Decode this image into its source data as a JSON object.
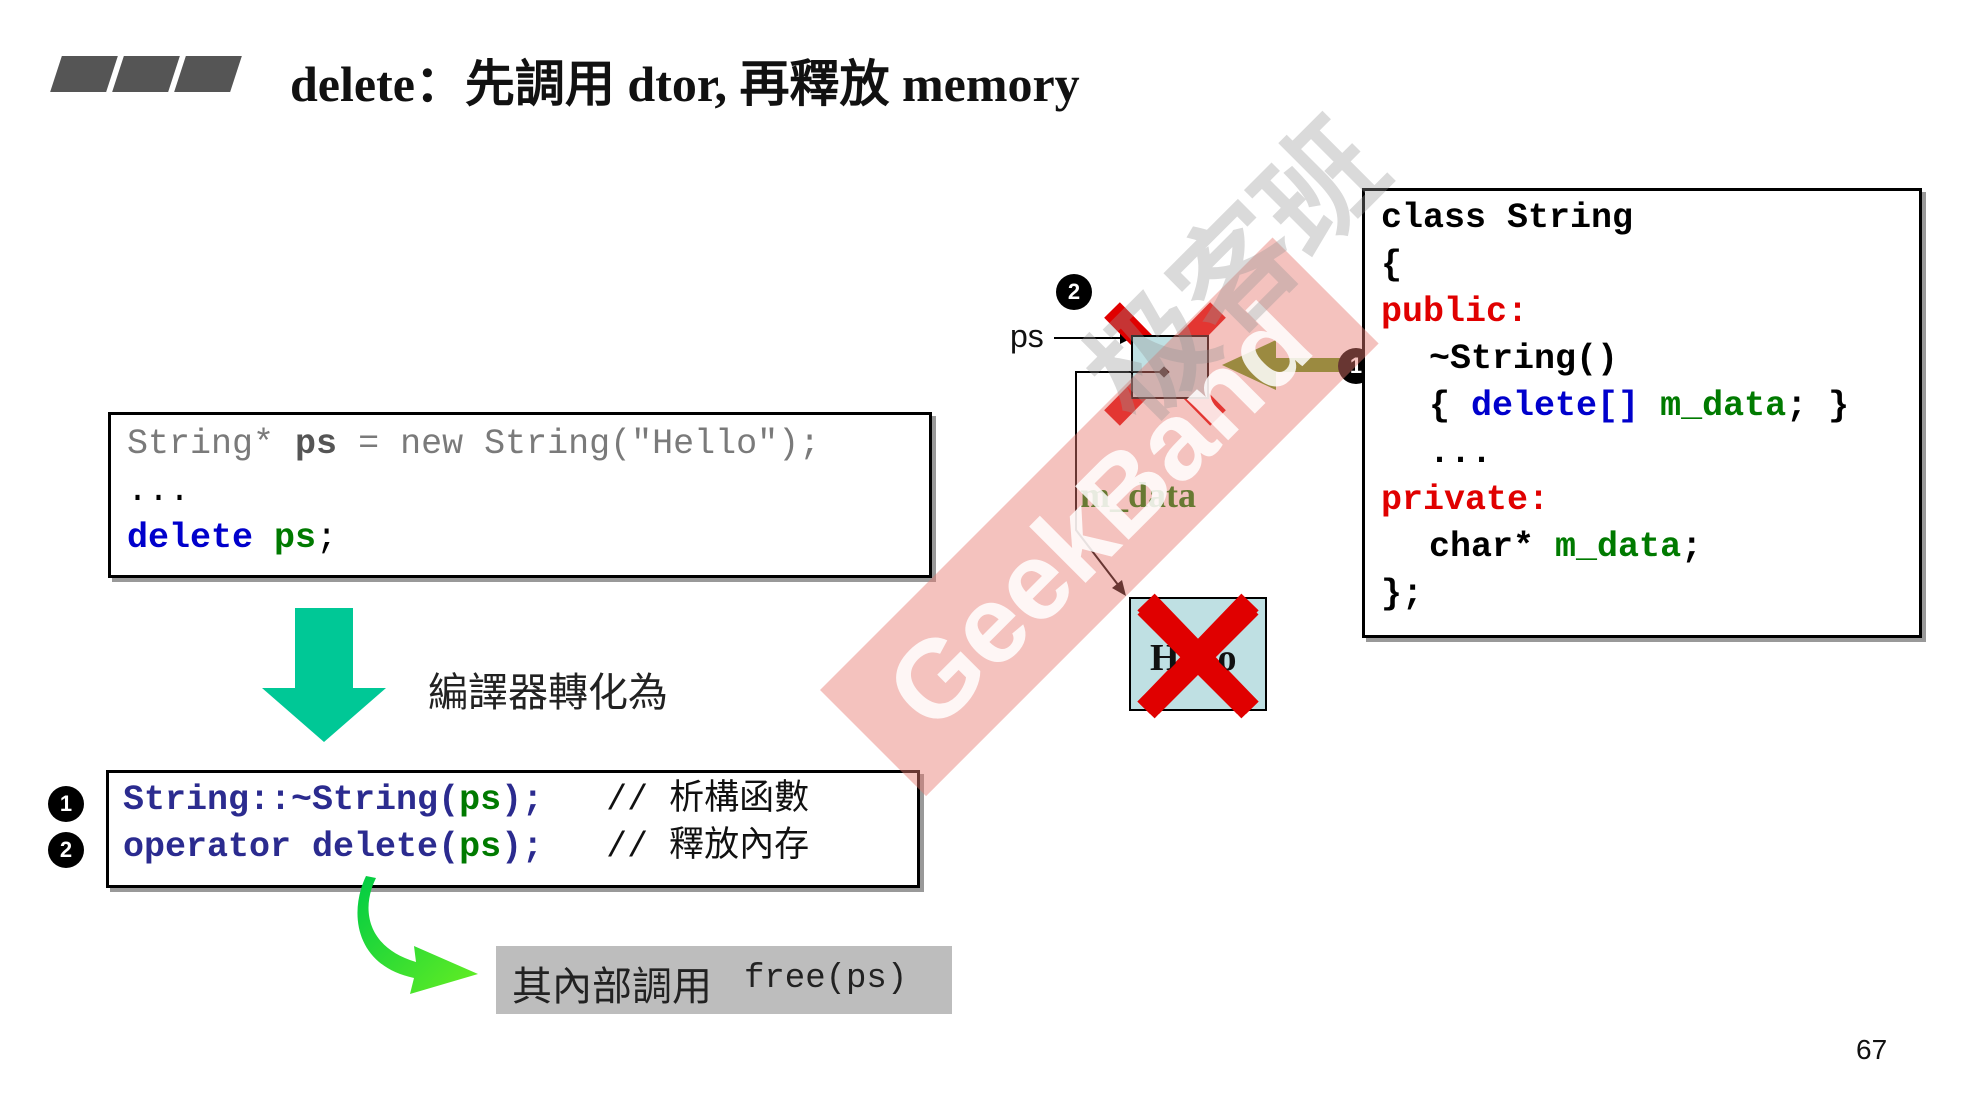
{
  "header": {
    "title": "delete：先調用 dtor, 再釋放 memory"
  },
  "source_code": {
    "line1": "String* ps = new String(\"Hello\");",
    "line1_parts": {
      "type": "String*",
      "var": "ps",
      "rest": " = new String(\"Hello\");"
    },
    "line2": "...",
    "line3_kw": "delete",
    "line3_var": "ps",
    "line3_end": ";"
  },
  "transform": {
    "label": "編譯器轉化為",
    "arrow_color": "#00c896"
  },
  "compiled_code": {
    "line1": {
      "func": "String::~String",
      "open": "(",
      "arg": "ps",
      "close": ");",
      "comment": "// 析構函數"
    },
    "line2": {
      "func": "operator delete",
      "open": "(",
      "arg": "ps",
      "close": ");",
      "comment": "// 釋放內存"
    },
    "badges": [
      "1",
      "2"
    ]
  },
  "free_call": {
    "prefix": "其內部調用",
    "call": "free(ps)",
    "background": "#bdbdbd"
  },
  "memory_diagram": {
    "ps_label": "ps",
    "m_data_label": "m_data",
    "string_content": "Hello",
    "badge_top": "2",
    "badge_dtor": "1",
    "cell_color": "#bfe0e3",
    "cross_color": "#e00000",
    "arrow_color": "#5e9a1a"
  },
  "class_def": {
    "line1": "class String",
    "line2": "{",
    "public": "public:",
    "dtor": "~String()",
    "body_open": "{ ",
    "body_kw": "delete[]",
    "body_var": "m_data",
    "body_close": "; }",
    "ellipsis": "...",
    "private": "private:",
    "member_type": "char*",
    "member_var": "m_data",
    "member_end": ";",
    "end": "};"
  },
  "watermark": {
    "brand": "GeekBand",
    "cjk": "极客班"
  },
  "page_number": "67"
}
